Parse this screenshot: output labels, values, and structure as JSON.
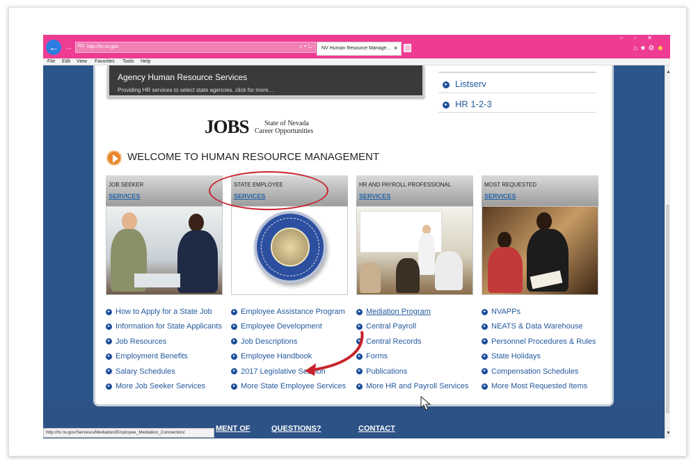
{
  "browser": {
    "address_url": "http://hr.nv.gov",
    "address_favicon": "NV",
    "address_tools": "⌕ ▾ ↻",
    "tab_label": "Human Resource Manage...",
    "tab_favicon": "NV",
    "menu": [
      "File",
      "Edit",
      "View",
      "Favorites",
      "Tools",
      "Help"
    ],
    "status_url": "http://hr.nv.gov/Services/Mediation/Employee_Mediation_Connection/"
  },
  "banner": {
    "title": "Agency Human Resource Services",
    "subtitle": "Providing HR services to select state agencies. click for more..."
  },
  "top_links": [
    "Listserv",
    "HR 1-2-3"
  ],
  "logo": {
    "word": "JOBS",
    "line1": "State of Nevada",
    "line2": "Career Opportunities"
  },
  "welcome_title": "WELCOME TO HUMAN RESOURCE MANAGEMENT",
  "columns": [
    {
      "category": "JOB SEEKER",
      "services": "SERVICES",
      "links": [
        "How to Apply for a State Job",
        "Information for State Applicants",
        "Job Resources",
        "Employment Benefits",
        "Salary Schedules",
        "More Job Seeker Services"
      ]
    },
    {
      "category": "STATE EMPLOYEE",
      "services": "SERVICES",
      "links": [
        "Employee Assistance Program",
        "Employee Development",
        "Job Descriptions",
        "Employee Handbook",
        "2017 Legislative Session",
        "More State Employee Services"
      ]
    },
    {
      "category": "HR AND PAYROLL PROFESSIONAL",
      "services": "SERVICES",
      "links": [
        "Mediation Program",
        "Central Payroll",
        "Central Records",
        "Forms",
        "Publications",
        "More HR and Payroll Services"
      ]
    },
    {
      "category": "MOST REQUESTED",
      "services": "SERVICES",
      "links": [
        "NVAPPs",
        "NEATS & Data Warehouse",
        "Personnel Procedures & Rules",
        "State Holidays",
        "Compensation Schedules",
        "More Most Requested Items"
      ]
    }
  ],
  "footer_links": [
    "MENT OF",
    "QUESTIONS?",
    "CONTACT"
  ],
  "colors": {
    "titlebar": "#ee3c93",
    "page_bg": "#2b568c",
    "link": "#24599e",
    "annotation": "#c8232c"
  }
}
